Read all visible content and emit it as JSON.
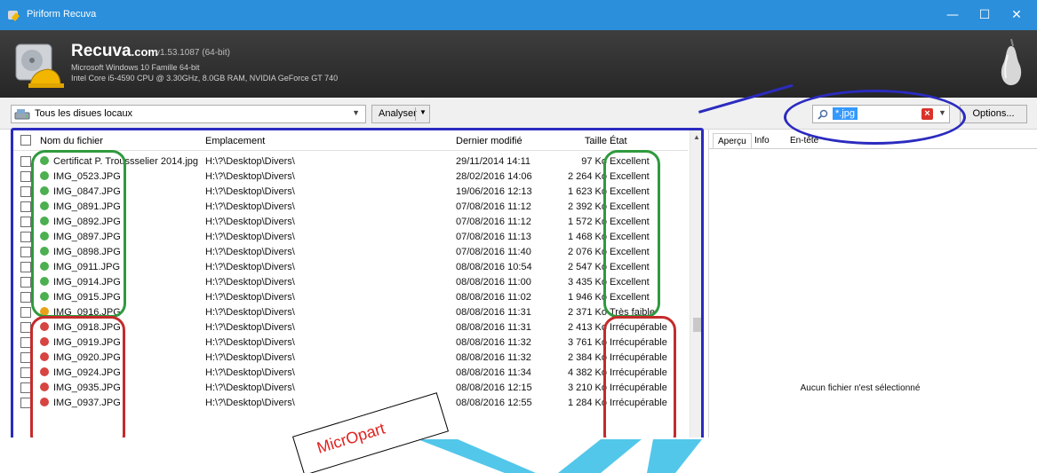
{
  "window": {
    "title": "Piriform Recuva",
    "minimize": "—",
    "maximize": "☐",
    "close": "✕",
    "icon": "recuva-app-icon"
  },
  "header": {
    "brand": "Recuva",
    "brand_suffix": ".com",
    "version": "v1.53.1087 (64-bit)",
    "os": "Microsoft Windows 10 Famille 64-bit",
    "hardware": "Intel Core i5-4590 CPU @ 3.30GHz, 8.0GB RAM, NVIDIA GeForce GT 740"
  },
  "toolbar": {
    "drive_label": "Tous les disues locaux",
    "analyse_label": "Analyser",
    "filter_value": "*.jpg",
    "options_label": "Options..."
  },
  "columns": {
    "name": "Nom du fichier",
    "path": "Emplacement",
    "date": "Dernier modifié",
    "size": "Taille",
    "state": "État"
  },
  "status_colors": {
    "excellent": "#4caf50",
    "low": "#e8a21a",
    "unrecoverable": "#d64541"
  },
  "rows": [
    {
      "name": "Certificat P. Troussselier 2014.jpg",
      "path": "H:\\?\\Desktop\\Divers\\",
      "date": "29/11/2014 14:11",
      "size": "97 Ko",
      "state": "Excellent",
      "level": "excellent"
    },
    {
      "name": "IMG_0523.JPG",
      "path": "H:\\?\\Desktop\\Divers\\",
      "date": "28/02/2016 14:06",
      "size": "2 264 Ko",
      "state": "Excellent",
      "level": "excellent"
    },
    {
      "name": "IMG_0847.JPG",
      "path": "H:\\?\\Desktop\\Divers\\",
      "date": "19/06/2016 12:13",
      "size": "1 623 Ko",
      "state": "Excellent",
      "level": "excellent"
    },
    {
      "name": "IMG_0891.JPG",
      "path": "H:\\?\\Desktop\\Divers\\",
      "date": "07/08/2016 11:12",
      "size": "2 392 Ko",
      "state": "Excellent",
      "level": "excellent"
    },
    {
      "name": "IMG_0892.JPG",
      "path": "H:\\?\\Desktop\\Divers\\",
      "date": "07/08/2016 11:12",
      "size": "1 572 Ko",
      "state": "Excellent",
      "level": "excellent"
    },
    {
      "name": "IMG_0897.JPG",
      "path": "H:\\?\\Desktop\\Divers\\",
      "date": "07/08/2016 11:13",
      "size": "1 468 Ko",
      "state": "Excellent",
      "level": "excellent"
    },
    {
      "name": "IMG_0898.JPG",
      "path": "H:\\?\\Desktop\\Divers\\",
      "date": "07/08/2016 11:40",
      "size": "2 076 Ko",
      "state": "Excellent",
      "level": "excellent"
    },
    {
      "name": "IMG_0911.JPG",
      "path": "H:\\?\\Desktop\\Divers\\",
      "date": "08/08/2016 10:54",
      "size": "2 547 Ko",
      "state": "Excellent",
      "level": "excellent"
    },
    {
      "name": "IMG_0914.JPG",
      "path": "H:\\?\\Desktop\\Divers\\",
      "date": "08/08/2016 11:00",
      "size": "3 435 Ko",
      "state": "Excellent",
      "level": "excellent"
    },
    {
      "name": "IMG_0915.JPG",
      "path": "H:\\?\\Desktop\\Divers\\",
      "date": "08/08/2016 11:02",
      "size": "1 946 Ko",
      "state": "Excellent",
      "level": "excellent"
    },
    {
      "name": "IMG_0916.JPG",
      "path": "H:\\?\\Desktop\\Divers\\",
      "date": "08/08/2016 11:31",
      "size": "2 371 Ko",
      "state": "Très faible",
      "level": "low"
    },
    {
      "name": "IMG_0918.JPG",
      "path": "H:\\?\\Desktop\\Divers\\",
      "date": "08/08/2016 11:31",
      "size": "2 413 Ko",
      "state": "Irrécupérable",
      "level": "unrecoverable"
    },
    {
      "name": "IMG_0919.JPG",
      "path": "H:\\?\\Desktop\\Divers\\",
      "date": "08/08/2016 11:32",
      "size": "3 761 Ko",
      "state": "Irrécupérable",
      "level": "unrecoverable"
    },
    {
      "name": "IMG_0920.JPG",
      "path": "H:\\?\\Desktop\\Divers\\",
      "date": "08/08/2016 11:32",
      "size": "2 384 Ko",
      "state": "Irrécupérable",
      "level": "unrecoverable"
    },
    {
      "name": "IMG_0924.JPG",
      "path": "H:\\?\\Desktop\\Divers\\",
      "date": "08/08/2016 11:34",
      "size": "4 382 Ko",
      "state": "Irrécupérable",
      "level": "unrecoverable"
    },
    {
      "name": "IMG_0935.JPG",
      "path": "H:\\?\\Desktop\\Divers\\",
      "date": "08/08/2016 12:15",
      "size": "3 210 Ko",
      "state": "Irrécupérable",
      "level": "unrecoverable"
    },
    {
      "name": "IMG_0937.JPG",
      "path": "H:\\?\\Desktop\\Divers\\",
      "date": "08/08/2016 12:55",
      "size": "1 284 Ko",
      "state": "Irrécupérable",
      "level": "unrecoverable"
    }
  ],
  "preview": {
    "tabs": [
      "Aperçu",
      "Info",
      "En-tête"
    ],
    "empty_message": "Aucun fichier n'est sélectionné"
  },
  "annotations": {
    "stamp_text": "MicrOpart",
    "colors": {
      "blue": "#2b2bbf",
      "green": "#2f9a3e",
      "red": "#c42b2b",
      "watermark": "#3fc1e8"
    }
  }
}
